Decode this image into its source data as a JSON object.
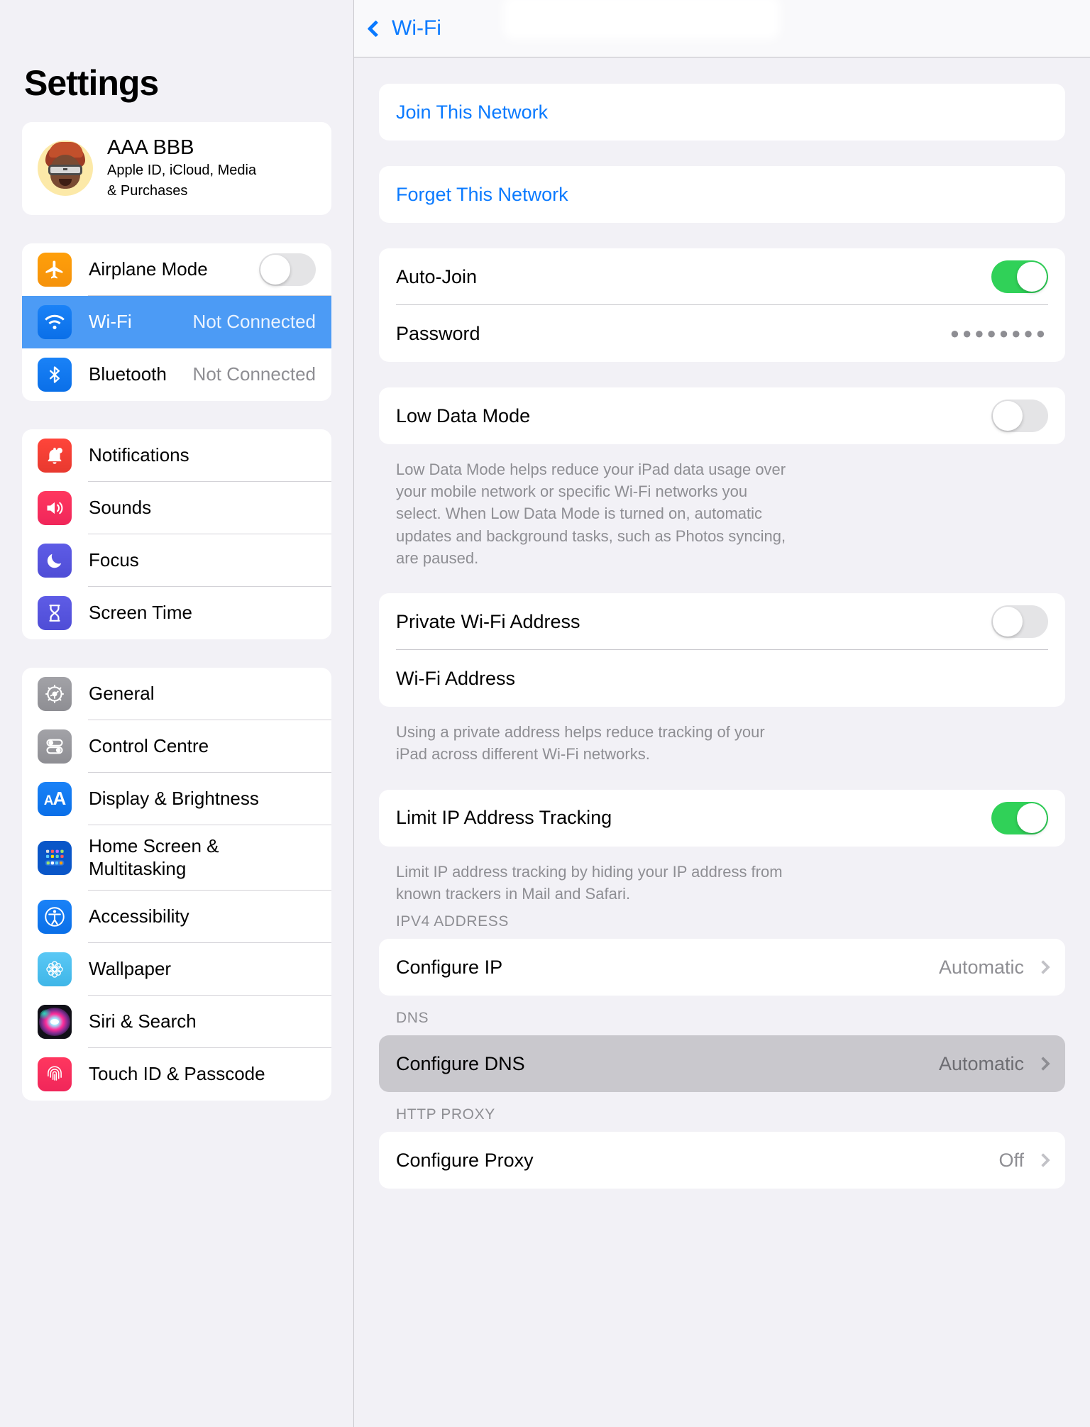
{
  "sidebar": {
    "title": "Settings",
    "account": {
      "name": "AAA BBB",
      "subtitle_line1": "Apple ID, iCloud, Media",
      "subtitle_line2": "& Purchases"
    },
    "group_connectivity": [
      {
        "label": "Airplane Mode",
        "icon": "airplane-icon",
        "control": "toggle",
        "value": "off"
      },
      {
        "label": "Wi-Fi",
        "icon": "wifi-icon",
        "value": "Not Connected",
        "selected": true
      },
      {
        "label": "Bluetooth",
        "icon": "bluetooth-icon",
        "value": "Not Connected"
      }
    ],
    "group_alerts": [
      {
        "label": "Notifications",
        "icon": "bell-icon"
      },
      {
        "label": "Sounds",
        "icon": "speaker-icon"
      },
      {
        "label": "Focus",
        "icon": "moon-icon"
      },
      {
        "label": "Screen Time",
        "icon": "hourglass-icon"
      }
    ],
    "group_system": [
      {
        "label": "General",
        "icon": "gear-icon"
      },
      {
        "label": "Control Centre",
        "icon": "sliders-icon"
      },
      {
        "label": "Display & Brightness",
        "icon": "text-size-icon"
      },
      {
        "label": "Home Screen & Multitasking",
        "icon": "home-grid-icon"
      },
      {
        "label": "Accessibility",
        "icon": "accessibility-icon"
      },
      {
        "label": "Wallpaper",
        "icon": "flower-icon"
      },
      {
        "label": "Siri & Search",
        "icon": "siri-icon"
      },
      {
        "label": "Touch ID & Passcode",
        "icon": "fingerprint-icon"
      }
    ]
  },
  "detail": {
    "back_label": "Wi-Fi",
    "join_network": "Join This Network",
    "forget_network": "Forget This Network",
    "auto_join": {
      "label": "Auto-Join",
      "state": "on"
    },
    "password": {
      "label": "Password",
      "masked": "●●●●●●●●"
    },
    "low_data_mode": {
      "label": "Low Data Mode",
      "state": "off"
    },
    "low_data_footnote": "Low Data Mode helps reduce your iPad data usage over your mobile network or specific Wi-Fi networks you select. When Low Data Mode is turned on, automatic updates and background tasks, such as Photos syncing, are paused.",
    "private_wifi_address": {
      "label": "Private Wi-Fi Address",
      "state": "off"
    },
    "wifi_address": {
      "label": "Wi-Fi Address",
      "value": ""
    },
    "private_footnote": "Using a private address helps reduce tracking of your iPad across different Wi-Fi networks.",
    "limit_ip_tracking": {
      "label": "Limit IP Address Tracking",
      "state": "on"
    },
    "limit_footnote": "Limit IP address tracking by hiding your IP address from known trackers in Mail and Safari.",
    "ipv4_header": "IPV4 ADDRESS",
    "configure_ip": {
      "label": "Configure IP",
      "value": "Automatic"
    },
    "dns_header": "DNS",
    "configure_dns": {
      "label": "Configure DNS",
      "value": "Automatic",
      "highlighted": true
    },
    "http_proxy_header": "HTTP PROXY",
    "configure_proxy": {
      "label": "Configure Proxy",
      "value": "Off"
    }
  },
  "colors": {
    "accent_blue": "#0a7aff",
    "selection_blue": "#4c9bf5",
    "toggle_green": "#30d158",
    "page_bg": "#f2f1f6"
  }
}
